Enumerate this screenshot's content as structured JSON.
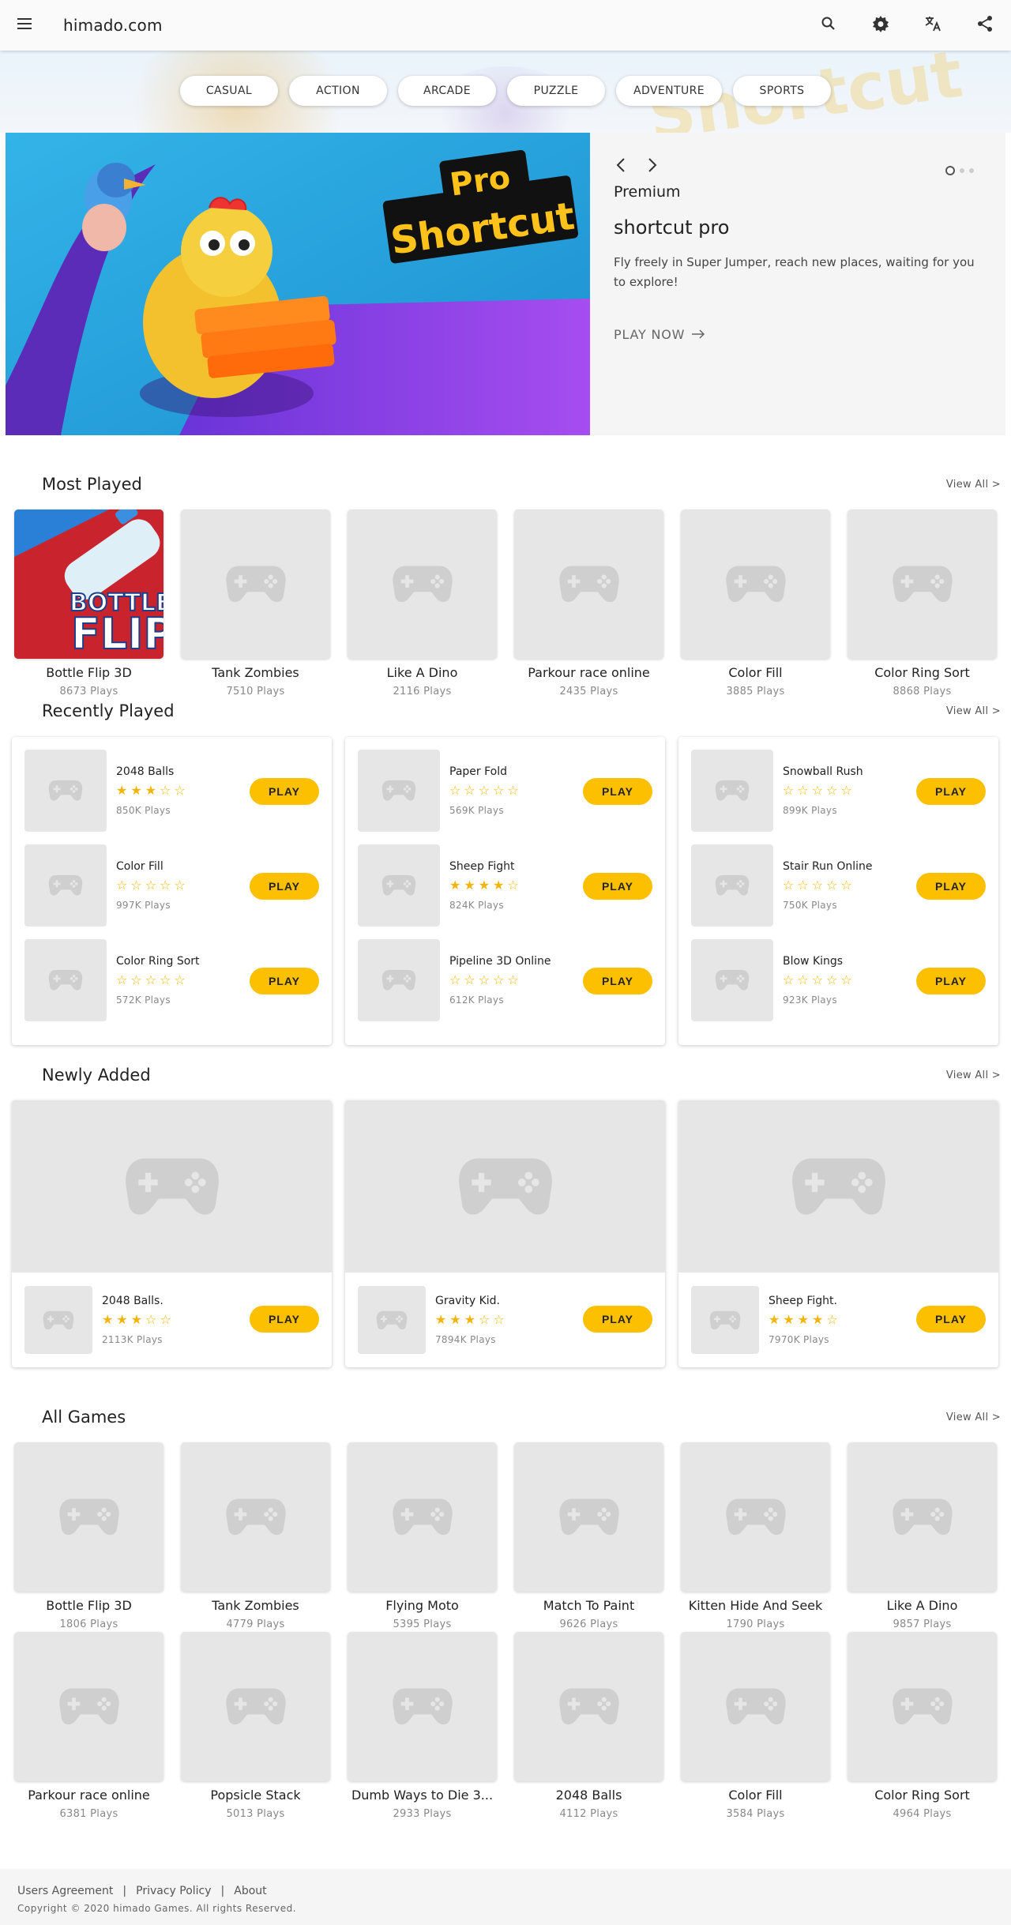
{
  "header": {
    "site_name": "himado.com",
    "menu_icon": "menu-icon",
    "icons": [
      "search-icon",
      "settings-icon",
      "translate-icon",
      "share-icon"
    ]
  },
  "categories": [
    "CASUAL",
    "ACTION",
    "ARCADE",
    "PUZZLE",
    "ADVENTURE",
    "SPORTS"
  ],
  "carousel": {
    "label": "Premium",
    "title": "shortcut pro",
    "description": "Fly freely in Super Jumper, reach new places, waiting for you to explore!",
    "cta": "PLAY NOW",
    "image_text_top": "Pro",
    "image_text_bottom": "Shortcut",
    "slide_count": 3,
    "active_slide": 1
  },
  "most_played": {
    "title": "Most Played",
    "view_all": "View All >",
    "items": [
      {
        "name": "Bottle Flip 3D",
        "plays": "8673 Plays",
        "thumb_text_1": "BOTTLE",
        "thumb_text_2": "FLIP"
      },
      {
        "name": "Tank Zombies",
        "plays": "7510 Plays"
      },
      {
        "name": "Like A Dino",
        "plays": "2116 Plays"
      },
      {
        "name": "Parkour race online",
        "plays": "2435 Plays"
      },
      {
        "name": "Color Fill",
        "plays": "3885 Plays"
      },
      {
        "name": "Color Ring Sort",
        "plays": "8868 Plays"
      }
    ]
  },
  "recently_played": {
    "title": "Recently Played",
    "view_all": "View All >",
    "play_label": "PLAY",
    "columns": [
      [
        {
          "name": "2048 Balls",
          "rating": 3,
          "plays": "850K Plays"
        },
        {
          "name": "Color Fill",
          "rating": 0,
          "plays": "997K Plays"
        },
        {
          "name": "Color Ring Sort",
          "rating": 0,
          "plays": "572K Plays"
        }
      ],
      [
        {
          "name": "Paper Fold",
          "rating": 0,
          "plays": "569K Plays"
        },
        {
          "name": "Sheep Fight",
          "rating": 4,
          "plays": "824K Plays"
        },
        {
          "name": "Pipeline 3D Online",
          "rating": 0,
          "plays": "612K Plays"
        }
      ],
      [
        {
          "name": "Snowball Rush",
          "rating": 0,
          "plays": "899K Plays"
        },
        {
          "name": "Stair Run Online",
          "rating": 0,
          "plays": "750K Plays"
        },
        {
          "name": "Blow Kings",
          "rating": 0,
          "plays": "923K Plays"
        }
      ]
    ]
  },
  "newly_added": {
    "title": "Newly Added",
    "view_all": "View All >",
    "play_label": "PLAY",
    "items": [
      {
        "name": "2048 Balls.",
        "rating": 3,
        "plays": "2113K Plays"
      },
      {
        "name": "Gravity Kid.",
        "rating": 3,
        "plays": "7894K Plays"
      },
      {
        "name": "Sheep Fight.",
        "rating": 4,
        "plays": "7970K Plays"
      }
    ]
  },
  "all_games": {
    "title": "All Games",
    "view_all": "View All >",
    "rows": [
      [
        {
          "name": "Bottle Flip 3D",
          "plays": "1806 Plays"
        },
        {
          "name": "Tank Zombies",
          "plays": "4779 Plays"
        },
        {
          "name": "Flying Moto",
          "plays": "5395 Plays"
        },
        {
          "name": "Match To Paint",
          "plays": "9626 Plays"
        },
        {
          "name": "Kitten Hide And Seek",
          "plays": "1790 Plays"
        },
        {
          "name": "Like A Dino",
          "plays": "9857 Plays"
        }
      ],
      [
        {
          "name": "Parkour race online",
          "plays": "6381 Plays"
        },
        {
          "name": "Popsicle Stack",
          "plays": "5013 Plays"
        },
        {
          "name": "Dumb Ways to Die 3...",
          "plays": "2933 Plays"
        },
        {
          "name": "2048 Balls",
          "plays": "4112 Plays"
        },
        {
          "name": "Color Fill",
          "plays": "3584 Plays"
        },
        {
          "name": "Color Ring Sort",
          "plays": "4964 Plays"
        }
      ]
    ]
  },
  "footer": {
    "links": [
      "Users Agreement",
      "Privacy Policy",
      "About"
    ],
    "separator": "|",
    "copyright": "Copyright © 2020 himado Games. All rights Reserved."
  },
  "colors": {
    "accent": "#fcc000",
    "star": "#f5b400",
    "placeholder": "#e6e6e6"
  }
}
